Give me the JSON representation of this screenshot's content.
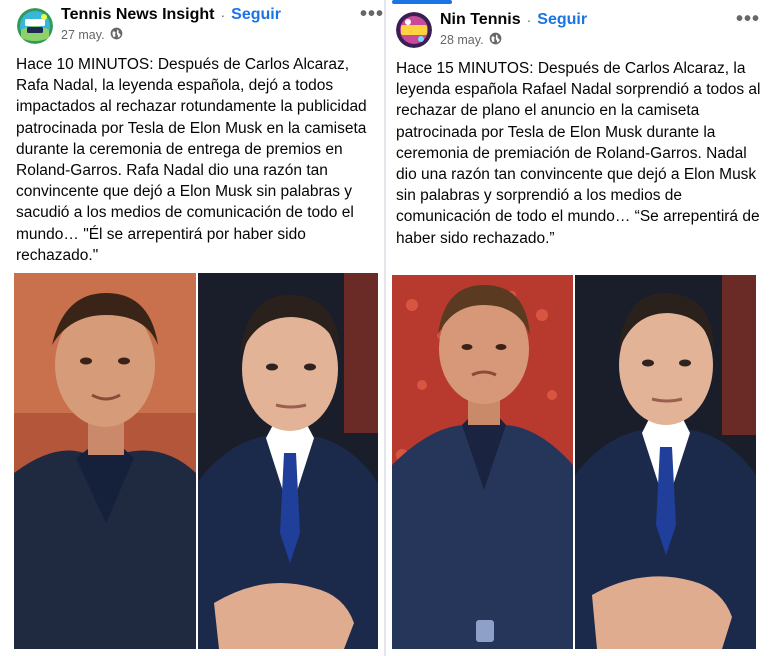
{
  "posts": [
    {
      "page_name": "Tennis News Insight",
      "separator": "·",
      "follow_label": "Seguir",
      "date": "27 may.",
      "more_label": "•••",
      "text": "Hace 10 MINUTOS: Después de Carlos Alcaraz, Rafa Nadal, la leyenda española, dejó a todos impactados al rechazar rotundamente la publicidad patrocinada por Tesla de Elon Musk en la camiseta durante la ceremonia de entrega de premios en Roland-Garros. Rafa Nadal dio una razón tan convincente que dejó a Elon Musk sin palabras y sacudió a los medios de comunicación de todo el mundo… \"Él se arrepentirá por haber sido rechazado.\"",
      "avatar_icon": "news-insight-logo",
      "privacy_icon": "globe-icon"
    },
    {
      "page_name": "Nin Tennis",
      "separator": "·",
      "follow_label": "Seguir",
      "date": "28 may.",
      "more_label": "•••",
      "text": "Hace 15 MINUTOS: Después de Carlos Alcaraz, la leyenda española Rafael Nadal sorprendió a todos al rechazar de plano el anuncio en la camiseta patrocinada por Tesla de Elon Musk durante la ceremonia de premiación de Roland-Garros. Nadal dio una razón tan convincente que dejó a Elon Musk sin palabras y sorprendió a los medios de comunicación de todo el mundo… “Se arrepentirá de haber sido rechazado.”",
      "avatar_icon": "nin-tennis-logo",
      "privacy_icon": "globe-icon"
    }
  ],
  "colors": {
    "accent": "#1b74e4",
    "text": "#050505",
    "muted": "#65676b"
  }
}
